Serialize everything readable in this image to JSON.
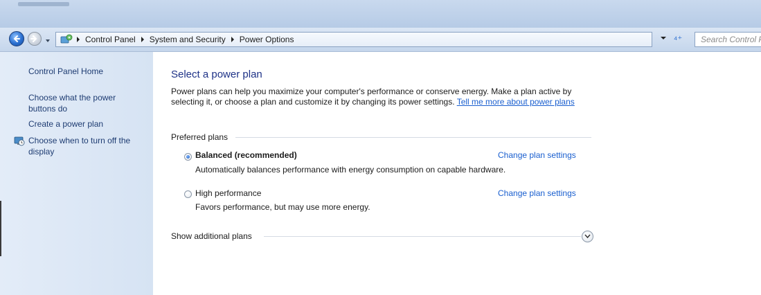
{
  "navigation": {
    "breadcrumbs": [
      "Control Panel",
      "System and Security",
      "Power Options"
    ],
    "search_placeholder": "Search Control Panel"
  },
  "sidebar": {
    "items": [
      {
        "label": "Control Panel Home"
      },
      {
        "label": "Choose what the power buttons do"
      },
      {
        "label": "Create a power plan"
      },
      {
        "label": "Choose when to turn off the display"
      }
    ]
  },
  "main": {
    "heading": "Select a power plan",
    "intro_text": "Power plans can help you maximize your computer's performance or conserve energy. Make a plan active by selecting it, or choose a plan and customize it by changing its power settings.",
    "intro_link": "Tell me more about power plans",
    "group_title": "Preferred plans",
    "plans": [
      {
        "name": "Balanced (recommended)",
        "description": "Automatically balances performance with energy consumption on capable hardware.",
        "link": "Change plan settings",
        "selected": true
      },
      {
        "name": "High performance",
        "description": "Favors performance, but may use more energy.",
        "link": "Change plan settings",
        "selected": false
      }
    ],
    "show_additional": "Show additional plans"
  },
  "colors": {
    "link": "#1a5fcf",
    "heading": "#1e3287",
    "sidebar_bg": "#dbe6f4"
  }
}
